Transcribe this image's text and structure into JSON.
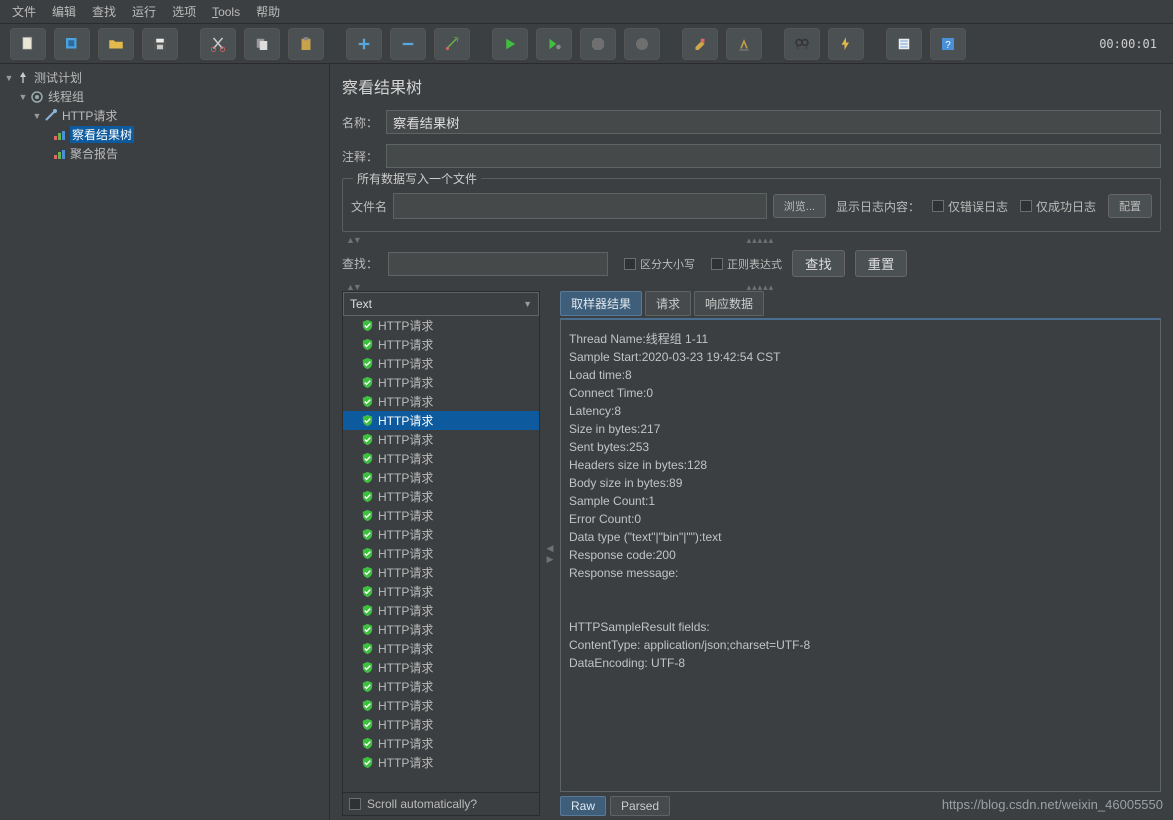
{
  "menu": [
    "文件",
    "编辑",
    "查找",
    "运行",
    "选项",
    "Tools",
    "帮助"
  ],
  "timer": "00:00:01",
  "tree": {
    "plan": "测试计划",
    "threadGroup": "线程组",
    "httpReq": "HTTP请求",
    "viewTree": "察看结果树",
    "aggReport": "聚合报告"
  },
  "panel": {
    "title": "察看结果树",
    "nameLabel": "名称：",
    "nameValue": "察看结果树",
    "commentLabel": "注释：",
    "commentValue": "",
    "writeGroup": "所有数据写入一个文件",
    "filenameLabel": "文件名",
    "browseBtn": "浏览...",
    "logContentLabel": "显示日志内容：",
    "onlyError": "仅错误日志",
    "onlySuccess": "仅成功日志",
    "configBtn": "配置",
    "searchLabel": "查找：",
    "caseSensitive": "区分大小写",
    "regex": "正则表达式",
    "searchBtn": "查找",
    "resetBtn": "重置",
    "renderer": "Text",
    "sampleLabel": "HTTP请求",
    "scrollAuto": "Scroll automatically?",
    "tabs": {
      "sampler": "取样器结果",
      "request": "请求",
      "response": "响应数据"
    },
    "rawTab": "Raw",
    "parsedTab": "Parsed"
  },
  "detail": {
    "lines": [
      "Thread Name:线程组 1-11",
      "Sample Start:2020-03-23 19:42:54 CST",
      "Load time:8",
      "Connect Time:0",
      "Latency:8",
      "Size in bytes:217",
      "Sent bytes:253",
      "Headers size in bytes:128",
      "Body size in bytes:89",
      "Sample Count:1",
      "Error Count:0",
      "Data type (\"text\"|\"bin\"|\"\"):text",
      "Response code:200",
      "Response message:",
      "",
      "",
      "HTTPSampleResult fields:",
      "ContentType: application/json;charset=UTF-8",
      "DataEncoding: UTF-8"
    ]
  },
  "sampleCount": 24,
  "selectedSample": 5,
  "watermark": "https://blog.csdn.net/weixin_46005550"
}
